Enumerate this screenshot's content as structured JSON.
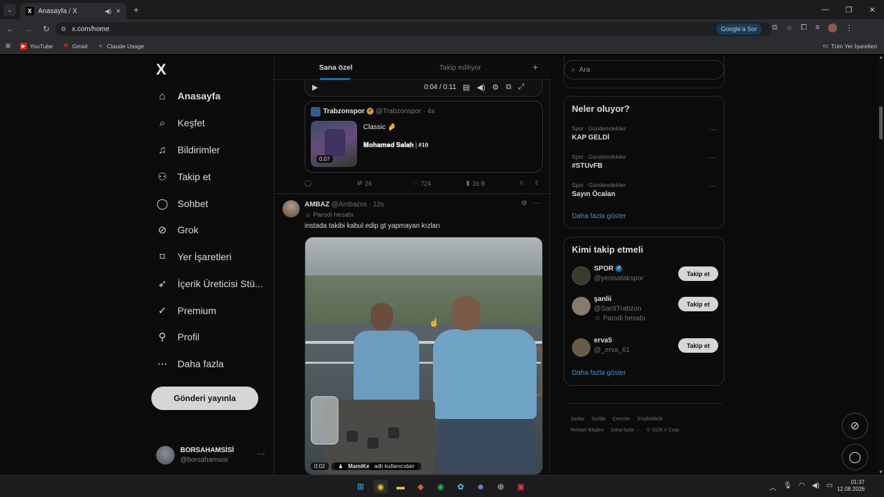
{
  "browser": {
    "tab_title": "Anasayfa / X",
    "url": "x.com/home",
    "google_sor": "Google'a Sor",
    "bookmarks": [
      {
        "label": "YouTube",
        "icon": "youtube-icon",
        "color": "#e62117"
      },
      {
        "label": "Gmail",
        "icon": "gmail-icon",
        "color": "#d93025"
      },
      {
        "label": "Claude Usage",
        "icon": "claude-icon",
        "color": "#d97757"
      }
    ],
    "all_bookmarks": "Tüm Yer İşaretleri"
  },
  "sidebar": {
    "logo": "X",
    "items": [
      {
        "label": "Anasayfa",
        "icon": "home-icon",
        "glyph": "⌂",
        "active": true
      },
      {
        "label": "Keşfet",
        "icon": "search-icon",
        "glyph": "⌕"
      },
      {
        "label": "Bildirimler",
        "icon": "bell-icon",
        "glyph": "♫"
      },
      {
        "label": "Takip et",
        "icon": "add-person-icon",
        "glyph": "⚇"
      },
      {
        "label": "Sohbet",
        "icon": "chat-bubble-icon",
        "glyph": "◯"
      },
      {
        "label": "Grok",
        "icon": "grok-icon",
        "glyph": "⊘"
      },
      {
        "label": "Yer İşaretleri",
        "icon": "bookmark-icon",
        "glyph": "⌑"
      },
      {
        "label": "İçerik Üreticisi Stü...",
        "icon": "rocket-icon",
        "glyph": "➶"
      },
      {
        "label": "Premium",
        "icon": "premium-check-icon",
        "glyph": "✓"
      },
      {
        "label": "Profil",
        "icon": "person-icon",
        "glyph": "⚲"
      },
      {
        "label": "Daha fazla",
        "icon": "more-circle-icon",
        "glyph": "⋯"
      }
    ],
    "post_button": "Gönderi yayınla",
    "account": {
      "name": "BORSAHAMSİSİ",
      "handle": "@borsahamsisi"
    }
  },
  "feed": {
    "tabs": [
      "Sana özel",
      "Takip ediliyor"
    ],
    "video": {
      "time": "0:04 / 0:11"
    },
    "quote": {
      "name": "Trabzonspor",
      "handle": "@Trabzonspor · 4s",
      "text": "Classic 🤌",
      "subtitle": "𝐌𝐨𝐡𝐚𝐦𝐞𝐝 𝐒𝐚𝐥𝐚𝐡 | #10",
      "duration": "0:07"
    },
    "stats": {
      "retweets": "26",
      "likes": "724",
      "views": "16 B"
    },
    "post2": {
      "name": "AMBAZ",
      "handle": "@Ambazss · 12s",
      "parody": "Parodi hesabı",
      "text": "instada takibi kabul edip gt yapmayan kızları",
      "duration": "0:02",
      "attribution_user": "MamiKe",
      "attribution_suffix": " adlı kullanıcıdan"
    }
  },
  "right": {
    "search_placeholder": "Ara",
    "trends_title": "Neler oluyor?",
    "trends": [
      {
        "category": "Spor · Gündemdekiler",
        "name": "KAP GELDİ"
      },
      {
        "category": "Spor · Gündemdekiler",
        "name": "#STUvFB"
      },
      {
        "category": "Spor · Gündemdekiler",
        "name": "Sayın Öcalan"
      }
    ],
    "show_more": "Daha fazla göster",
    "wtf_title": "Kimi takip etmeli",
    "users": [
      {
        "name": "SPOR",
        "handle": "@yenisafakspor",
        "parody": "",
        "verified": true,
        "color": "#3a3a2a"
      },
      {
        "name": "şanlii",
        "handle": "@SanliTrabzon",
        "parody": "Parodi hesabı",
        "verified": false,
        "color": "#8a7a6a"
      },
      {
        "name": "erva5",
        "handle": "@_erva_61",
        "parody": "",
        "verified": false,
        "color": "#6a5a4a"
      }
    ],
    "follow_label": "Takip et",
    "footer": [
      "Şartlar",
      "Gizlilik",
      "Çerezler",
      "Erişilebilirlik",
      "Reklam Bilgileri",
      "Daha fazla ···",
      "© 2026 X Corp."
    ]
  },
  "taskbar": {
    "time": "01:37",
    "date": "12.08.2026"
  }
}
